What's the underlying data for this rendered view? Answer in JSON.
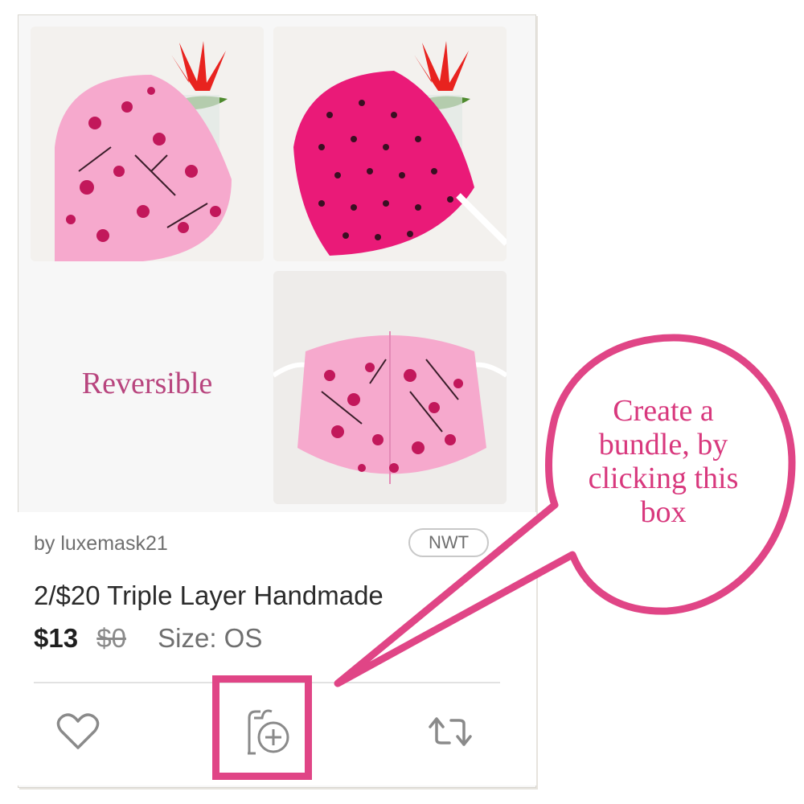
{
  "listing": {
    "image_caption": "Reversible",
    "seller": "by luxemask21",
    "condition_badge": "NWT",
    "title": "2/$20 Triple Layer Handmade",
    "price": "$13",
    "original_price": "$0",
    "size": "Size: OS"
  },
  "actions": [
    {
      "name": "like",
      "icon": "heart-icon"
    },
    {
      "name": "bundle",
      "icon": "add-to-bundle-icon"
    },
    {
      "name": "share",
      "icon": "share-icon"
    }
  ],
  "annotation": {
    "lines": [
      "Create a",
      "bundle, by",
      "clicking this",
      "box"
    ],
    "color": "#e04586"
  },
  "colors": {
    "accent_pink": "#e04586",
    "mask_light_pink": "#f6a9cd",
    "mask_hot_pink": "#ea1a78",
    "text_gray": "#6f6f6f"
  }
}
